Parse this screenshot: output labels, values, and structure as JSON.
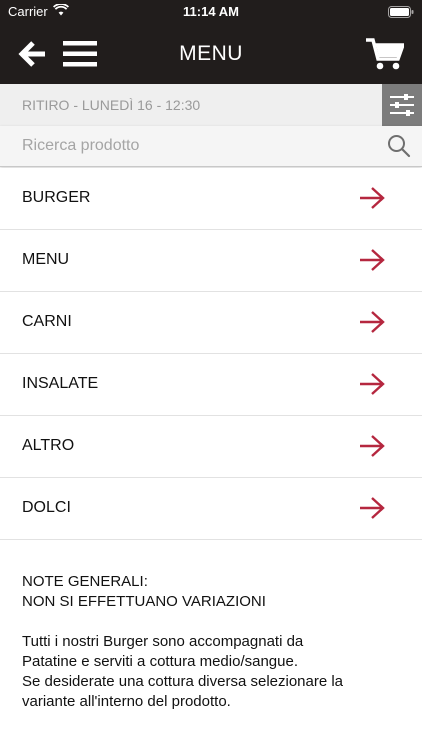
{
  "status_bar": {
    "carrier": "Carrier",
    "time": "11:14 AM"
  },
  "nav": {
    "title": "MENU"
  },
  "pickup": {
    "text": "RITIRO - LUNEDÌ 16 - 12:30"
  },
  "search": {
    "placeholder": "Ricerca prodotto",
    "value": ""
  },
  "categories": [
    {
      "label": "BURGER"
    },
    {
      "label": "MENU"
    },
    {
      "label": "CARNI"
    },
    {
      "label": "INSALATE"
    },
    {
      "label": "ALTRO"
    },
    {
      "label": "DOLCI"
    }
  ],
  "notes": {
    "line1": "NOTE GENERALI:",
    "line2": "NON SI EFFETTUANO VARIAZIONI",
    "line3": "Tutti i nostri Burger sono accompagnati da",
    "line4": "Patatine e serviti a cottura medio/sangue.",
    "line5": "Se desiderate una cottura diversa selezionare la",
    "line6": "variante all'interno del prodotto."
  },
  "colors": {
    "header_bg": "#211d1c",
    "accent_arrow": "#b5273f",
    "filter_bg": "#7c7c7c"
  },
  "icons": {
    "back": "arrow-left-icon",
    "menu": "hamburger-icon",
    "cart": "cart-icon",
    "filter": "sliders-icon",
    "search": "search-icon",
    "row_arrow": "arrow-right-icon"
  }
}
